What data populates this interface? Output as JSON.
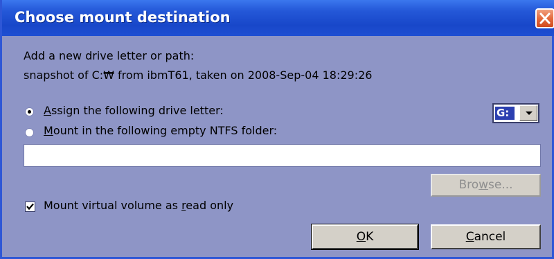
{
  "window": {
    "title": "Choose mount destination"
  },
  "intro": {
    "line1": "Add a new drive letter or path:",
    "line2": "snapshot of C:₩ from ibmT61, taken on 2008-Sep-04 18:29:26"
  },
  "options": {
    "assign_letter": {
      "accel": "A",
      "rest": "ssign the following drive letter:",
      "selected": true
    },
    "mount_folder": {
      "accel": "M",
      "rest": "ount in the following empty NTFS folder:",
      "selected": false
    }
  },
  "drive_select": {
    "value": "G:"
  },
  "folder_path": {
    "value": ""
  },
  "browse_button": {
    "pre": "Bro",
    "accel": "w",
    "post": "se..."
  },
  "readonly_checkbox": {
    "pre": "Mount virtual volume as ",
    "accel": "r",
    "post": "ead only",
    "checked": true
  },
  "ok_button": {
    "accel": "O",
    "post": "K"
  },
  "cancel_button": {
    "accel": "C",
    "post": "ancel"
  },
  "colors": {
    "titlebar": "#1f4fd2",
    "body": "#8e95c6",
    "close": "#e46b3e"
  },
  "icons": {
    "close": "close-icon",
    "check": "checkmark-icon"
  }
}
